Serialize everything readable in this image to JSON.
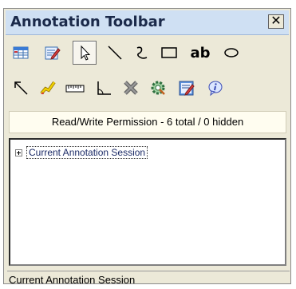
{
  "window": {
    "title": "Annotation Toolbar",
    "close_glyph": "✕"
  },
  "toolbar": {
    "row1": [
      {
        "name": "spreadsheet-icon",
        "color": "#3a7bd5"
      },
      {
        "name": "edit-document-icon",
        "color": "#d53a3a"
      },
      {
        "name": "select-arrow-icon",
        "color": "#000000",
        "selected": true
      },
      {
        "name": "line-icon",
        "color": "#000000"
      },
      {
        "name": "freehand-icon",
        "color": "#000000"
      },
      {
        "name": "rectangle-icon",
        "color": "#000000"
      },
      {
        "name": "text-tool-icon",
        "label": "ab"
      },
      {
        "name": "ellipse-icon",
        "color": "#000000"
      }
    ],
    "row2": [
      {
        "name": "arrow-icon",
        "color": "#000000"
      },
      {
        "name": "highlighter-icon",
        "color": "#f0d000"
      },
      {
        "name": "ruler-icon",
        "color": "#000000"
      },
      {
        "name": "angle-icon",
        "color": "#000000"
      },
      {
        "name": "delete-icon",
        "color": "#707070"
      },
      {
        "name": "settings-icon",
        "color": "#2f8f3f"
      },
      {
        "name": "notes-icon",
        "color": "#3a7bd5"
      },
      {
        "name": "info-icon",
        "color": "#3a4bb5"
      }
    ]
  },
  "permission": {
    "text": "Read/Write Permission - 6 total / 0 hidden"
  },
  "tree": {
    "root_label": "Current Annotation Session"
  },
  "status": {
    "text": "Current Annotation Session"
  }
}
